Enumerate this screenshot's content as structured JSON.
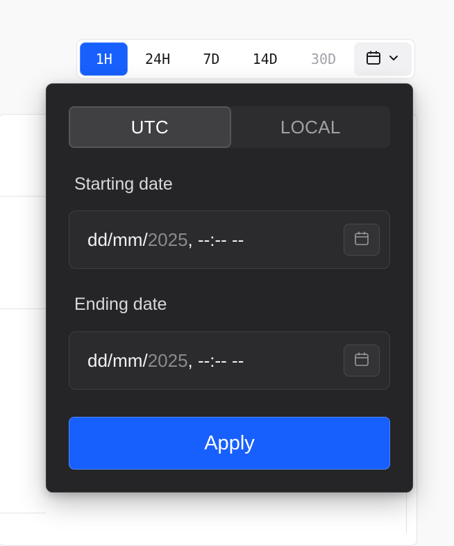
{
  "range_selector": {
    "options": [
      {
        "label": "1H",
        "state": "active"
      },
      {
        "label": "24H",
        "state": "normal"
      },
      {
        "label": "7D",
        "state": "normal"
      },
      {
        "label": "14D",
        "state": "normal"
      },
      {
        "label": "30D",
        "state": "disabled"
      }
    ],
    "custom_trigger_icon": "calendar-icon",
    "custom_trigger_chevron": "chevron-down-icon"
  },
  "popover": {
    "timezone": {
      "options": [
        "UTC",
        "LOCAL"
      ],
      "selected": "UTC"
    },
    "start": {
      "label": "Starting date",
      "value_day_month": "dd/mm/",
      "value_year": "2025",
      "value_time": ", --:-- --",
      "picker_icon": "calendar-icon"
    },
    "end": {
      "label": "Ending date",
      "value_day_month": "dd/mm/",
      "value_year": "2025",
      "value_time": ", --:-- --",
      "picker_icon": "calendar-icon"
    },
    "apply_label": "Apply"
  },
  "colors": {
    "accent": "#1760fd",
    "popover_bg": "#252527",
    "page_bg": "#f9f9fa"
  }
}
